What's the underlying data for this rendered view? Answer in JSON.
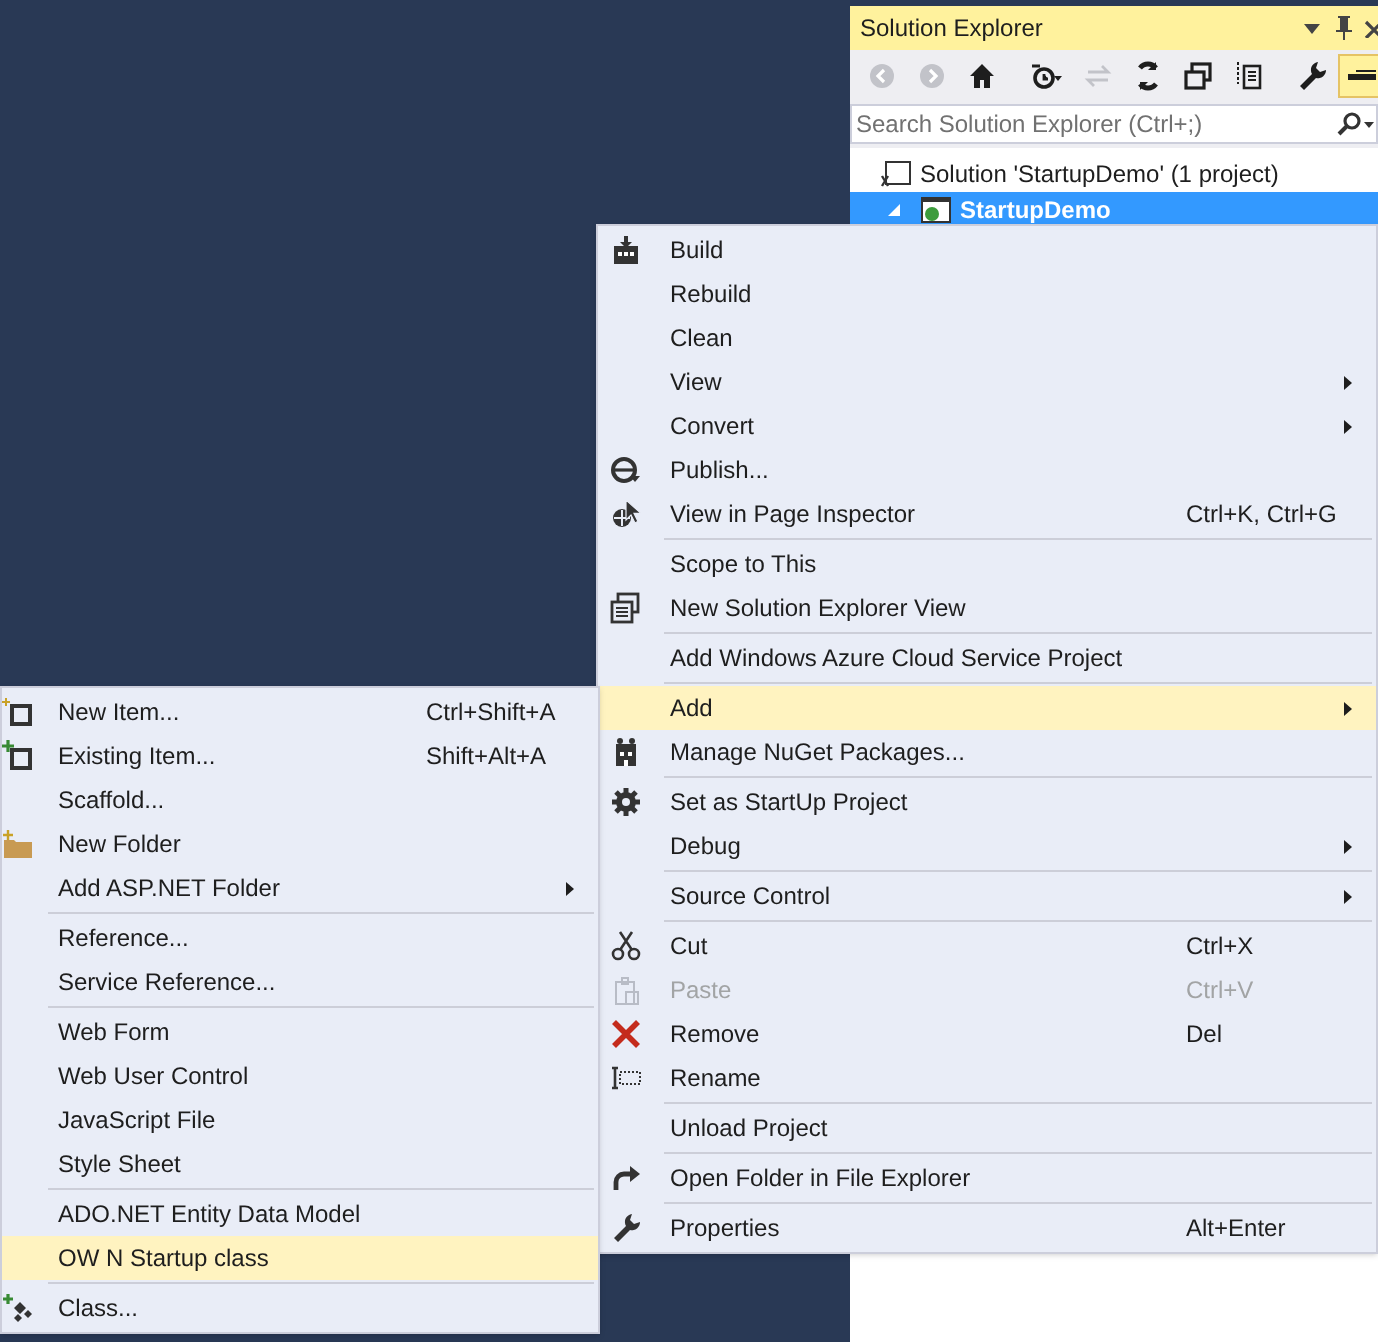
{
  "solution_explorer": {
    "title": "Solution Explorer",
    "toolbar": [
      {
        "disabled": true,
        "on": false
      },
      {
        "disabled": true,
        "on": false
      },
      {
        "disabled": false,
        "on": false
      },
      {
        "disabled": false,
        "on": false
      },
      {
        "disabled": true,
        "on": false
      },
      {
        "disabled": false,
        "on": false
      },
      {
        "disabled": false,
        "on": false
      },
      {
        "disabled": false,
        "on": false
      },
      {
        "disabled": false,
        "on": false
      },
      {
        "disabled": false,
        "on": true
      }
    ],
    "search": {
      "placeholder": "Search Solution Explorer (Ctrl+;)"
    },
    "tree": [
      {
        "label": "Solution 'StartupDemo' (1 project)",
        "selected": false,
        "children": [
          {
            "label": "StartupDemo",
            "selected": true,
            "expanded": true
          }
        ]
      }
    ]
  },
  "context_menu": {
    "items": [
      {
        "kind": "item",
        "label": "Build",
        "submenu": false,
        "disabled": false,
        "selected": false
      },
      {
        "kind": "item",
        "label": "Rebuild",
        "submenu": false,
        "disabled": false,
        "selected": false
      },
      {
        "kind": "item",
        "label": "Clean",
        "submenu": false,
        "disabled": false,
        "selected": false
      },
      {
        "kind": "item",
        "label": "View",
        "submenu": true,
        "disabled": false,
        "selected": false
      },
      {
        "kind": "item",
        "label": "Convert",
        "submenu": true,
        "disabled": false,
        "selected": false
      },
      {
        "kind": "item",
        "label": "Publish...",
        "submenu": false,
        "disabled": false,
        "selected": false
      },
      {
        "kind": "item",
        "label": "View in Page Inspector",
        "shortcut": "Ctrl+K, Ctrl+G",
        "submenu": false,
        "disabled": false,
        "selected": false
      },
      {
        "kind": "separator"
      },
      {
        "kind": "item",
        "label": "Scope to This",
        "submenu": false,
        "disabled": false,
        "selected": false
      },
      {
        "kind": "item",
        "label": "New Solution Explorer View",
        "submenu": false,
        "disabled": false,
        "selected": false
      },
      {
        "kind": "separator"
      },
      {
        "kind": "item",
        "label": "Add Windows Azure Cloud Service Project",
        "submenu": false,
        "disabled": false,
        "selected": false
      },
      {
        "kind": "separator"
      },
      {
        "kind": "item",
        "label": "Add",
        "submenu": true,
        "disabled": false,
        "selected": true
      },
      {
        "kind": "item",
        "label": "Manage NuGet Packages...",
        "submenu": false,
        "disabled": false,
        "selected": false
      },
      {
        "kind": "separator"
      },
      {
        "kind": "item",
        "label": "Set as StartUp Project",
        "submenu": false,
        "disabled": false,
        "selected": false
      },
      {
        "kind": "item",
        "label": "Debug",
        "submenu": true,
        "disabled": false,
        "selected": false
      },
      {
        "kind": "separator"
      },
      {
        "kind": "item",
        "label": "Source Control",
        "submenu": true,
        "disabled": false,
        "selected": false
      },
      {
        "kind": "separator"
      },
      {
        "kind": "item",
        "label": "Cut",
        "shortcut": "Ctrl+X",
        "submenu": false,
        "disabled": false,
        "selected": false
      },
      {
        "kind": "item",
        "label": "Paste",
        "shortcut": "Ctrl+V",
        "submenu": false,
        "disabled": true,
        "selected": false
      },
      {
        "kind": "item",
        "label": "Remove",
        "shortcut": "Del",
        "submenu": false,
        "disabled": false,
        "selected": false
      },
      {
        "kind": "item",
        "label": "Rename",
        "submenu": false,
        "disabled": false,
        "selected": false
      },
      {
        "kind": "separator"
      },
      {
        "kind": "item",
        "label": "Unload Project",
        "submenu": false,
        "disabled": false,
        "selected": false
      },
      {
        "kind": "separator"
      },
      {
        "kind": "item",
        "label": "Open Folder in File Explorer",
        "submenu": false,
        "disabled": false,
        "selected": false
      },
      {
        "kind": "separator"
      },
      {
        "kind": "item",
        "label": "Properties",
        "shortcut": "Alt+Enter",
        "submenu": false,
        "disabled": false,
        "selected": false
      }
    ]
  },
  "add_submenu": {
    "items": [
      {
        "kind": "item",
        "label": "New Item...",
        "shortcut": "Ctrl+Shift+A",
        "submenu": false,
        "disabled": false,
        "selected": false
      },
      {
        "kind": "item",
        "label": "Existing Item...",
        "shortcut": "Shift+Alt+A",
        "submenu": false,
        "disabled": false,
        "selected": false
      },
      {
        "kind": "item",
        "label": "Scaffold...",
        "submenu": false,
        "disabled": false,
        "selected": false
      },
      {
        "kind": "item",
        "label": "New Folder",
        "submenu": false,
        "disabled": false,
        "selected": false
      },
      {
        "kind": "item",
        "label": "Add ASP.NET Folder",
        "submenu": true,
        "disabled": false,
        "selected": false
      },
      {
        "kind": "separator"
      },
      {
        "kind": "item",
        "label": "Reference...",
        "submenu": false,
        "disabled": false,
        "selected": false
      },
      {
        "kind": "item",
        "label": "Service Reference...",
        "submenu": false,
        "disabled": false,
        "selected": false
      },
      {
        "kind": "separator"
      },
      {
        "kind": "item",
        "label": "Web Form",
        "submenu": false,
        "disabled": false,
        "selected": false
      },
      {
        "kind": "item",
        "label": "Web User Control",
        "submenu": false,
        "disabled": false,
        "selected": false
      },
      {
        "kind": "item",
        "label": "JavaScript File",
        "submenu": false,
        "disabled": false,
        "selected": false
      },
      {
        "kind": "item",
        "label": "Style Sheet",
        "submenu": false,
        "disabled": false,
        "selected": false
      },
      {
        "kind": "separator"
      },
      {
        "kind": "item",
        "label": "ADO.NET Entity Data Model",
        "submenu": false,
        "disabled": false,
        "selected": false
      },
      {
        "kind": "item",
        "label": "OW N Startup class",
        "submenu": false,
        "disabled": false,
        "selected": true
      },
      {
        "kind": "separator"
      },
      {
        "kind": "item",
        "label": "Class...",
        "submenu": false,
        "disabled": false,
        "selected": false
      }
    ]
  }
}
